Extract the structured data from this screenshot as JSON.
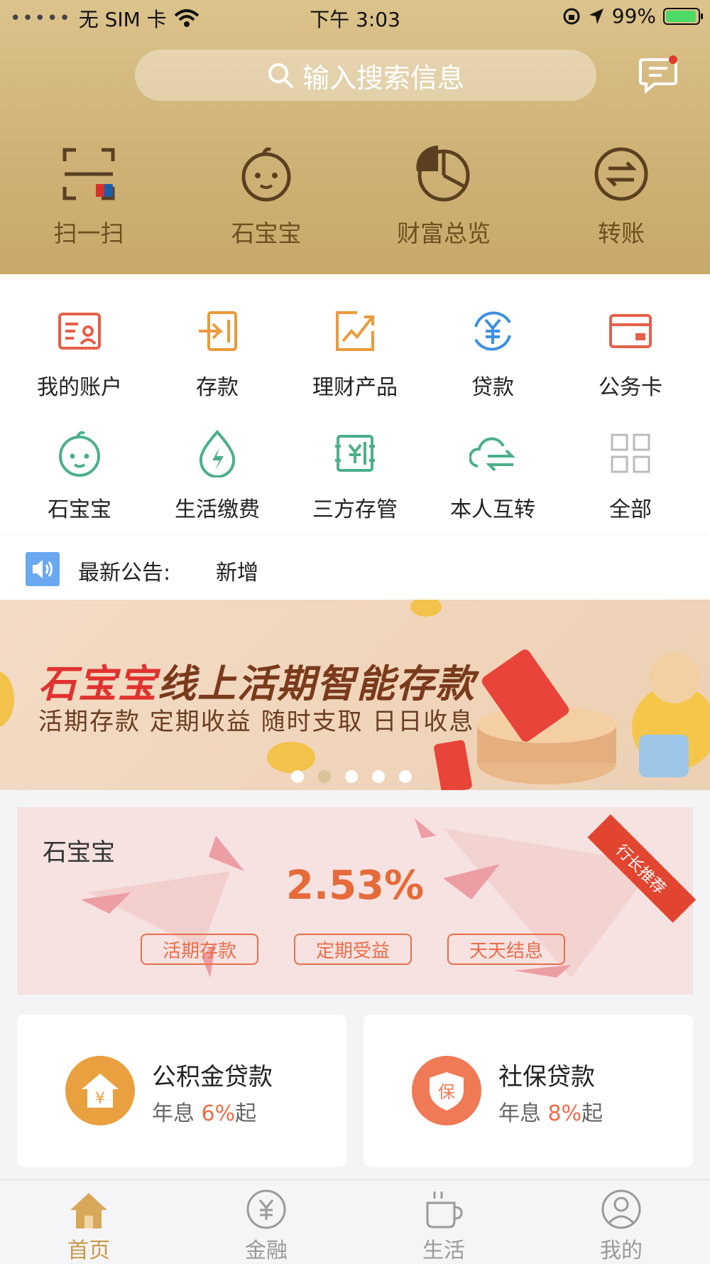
{
  "status": {
    "carrier": "无 SIM 卡",
    "time": "下午 3:03",
    "battery": "99%"
  },
  "search": {
    "placeholder": "输入搜索信息"
  },
  "quick_actions": [
    {
      "label": "扫一扫",
      "icon": "scan-icon"
    },
    {
      "label": "石宝宝",
      "icon": "baby-face-icon"
    },
    {
      "label": "财富总览",
      "icon": "pie-chart-icon"
    },
    {
      "label": "转账",
      "icon": "transfer-icon"
    }
  ],
  "services": [
    {
      "label": "我的账户",
      "icon": "account-card-icon"
    },
    {
      "label": "存款",
      "icon": "deposit-icon"
    },
    {
      "label": "理财产品",
      "icon": "trend-chart-icon"
    },
    {
      "label": "贷款",
      "icon": "yuan-cycle-icon"
    },
    {
      "label": "公务卡",
      "icon": "card-icon"
    },
    {
      "label": "石宝宝",
      "icon": "baby-face-icon"
    },
    {
      "label": "生活缴费",
      "icon": "lightning-drop-icon"
    },
    {
      "label": "三方存管",
      "icon": "custody-icon"
    },
    {
      "label": "本人互转",
      "icon": "cloud-transfer-icon"
    },
    {
      "label": "全部",
      "icon": "grid-icon"
    }
  ],
  "notice": {
    "label": "最新公告:",
    "text": "新增"
  },
  "banner": {
    "title_red": "石宝宝",
    "title_rest": "线上活期智能存款",
    "subtitle": "活期存款  定期收益  随时支取  日日收息",
    "pages": 5,
    "active_page": 2
  },
  "promo": {
    "name": "石宝宝",
    "rate": "2.53%",
    "ribbon": "行长推荐",
    "tags": [
      "活期存款",
      "定期受益",
      "天天结息"
    ]
  },
  "cards": [
    {
      "title": "公积金贷款",
      "prefix": "年息 ",
      "value": "6%",
      "suffix": "起",
      "color": "#e9a03e",
      "glyph": "¥"
    },
    {
      "title": "社保贷款",
      "prefix": "年息 ",
      "value": "8%",
      "suffix": "起",
      "color": "#ef7a55",
      "glyph": "保"
    }
  ],
  "tabs": [
    {
      "label": "首页",
      "icon": "home-icon",
      "active": true
    },
    {
      "label": "金融",
      "icon": "yuan-coin-icon",
      "active": false
    },
    {
      "label": "生活",
      "icon": "coffee-cup-icon",
      "active": false
    },
    {
      "label": "我的",
      "icon": "user-icon",
      "active": false
    }
  ],
  "colors": {
    "header_gold": "#cfb276",
    "accent_orange": "#e66a3a",
    "tab_active": "#c79a4a"
  }
}
